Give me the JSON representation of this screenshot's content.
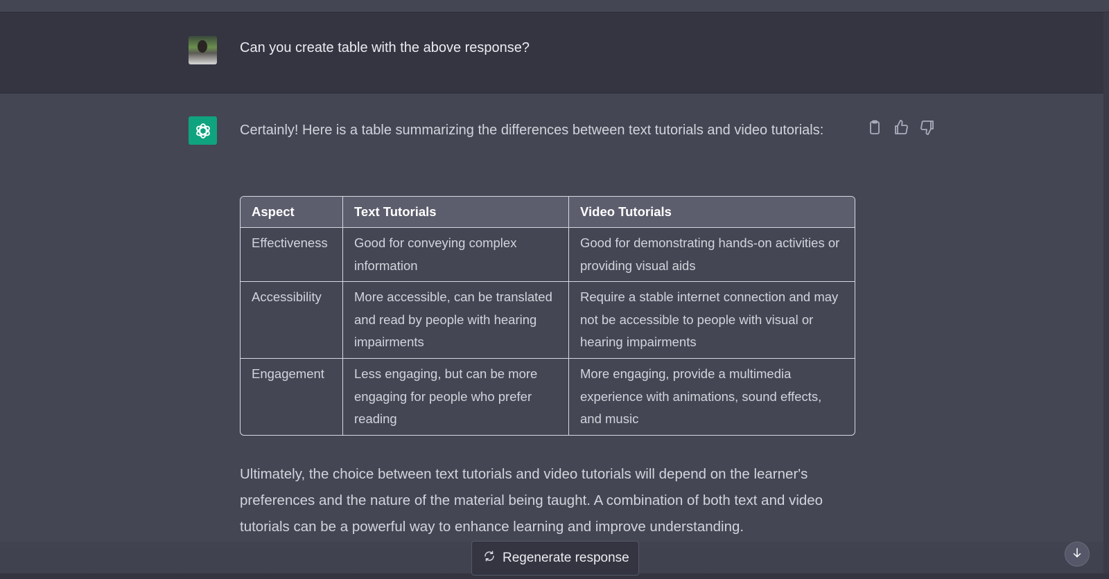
{
  "user_message": {
    "text": "Can you create table with the above response?"
  },
  "assistant_message": {
    "intro": "Certainly! Here is a table summarizing the differences between text tutorials and video tutorials:",
    "table": {
      "headers": [
        "Aspect",
        "Text Tutorials",
        "Video Tutorials"
      ],
      "rows": [
        [
          "Effectiveness",
          "Good for conveying complex information",
          "Good for demonstrating hands-on activities or providing visual aids"
        ],
        [
          "Accessibility",
          "More accessible, can be translated and read by people with hearing impairments",
          "Require a stable internet connection and may not be accessible to people with visual or hearing impairments"
        ],
        [
          "Engagement",
          "Less engaging, but can be more engaging for people who prefer reading",
          "More engaging, provide a multimedia experience with animations, sound effects, and music"
        ]
      ]
    },
    "conclusion": "Ultimately, the choice between text tutorials and video tutorials will depend on the learner's preferences and the nature of the material being taught. A combination of both text and video tutorials can be a powerful way to enhance learning and improve understanding."
  },
  "actions": {
    "regenerate_label": "Regenerate response"
  },
  "icons": [
    "copy-icon",
    "thumbs-up-icon",
    "thumbs-down-icon",
    "refresh-icon",
    "arrow-down-icon",
    "openai-logo-icon"
  ],
  "colors": {
    "brand": "#10a37f",
    "user_bg": "#343541",
    "assistant_bg": "#444654"
  }
}
